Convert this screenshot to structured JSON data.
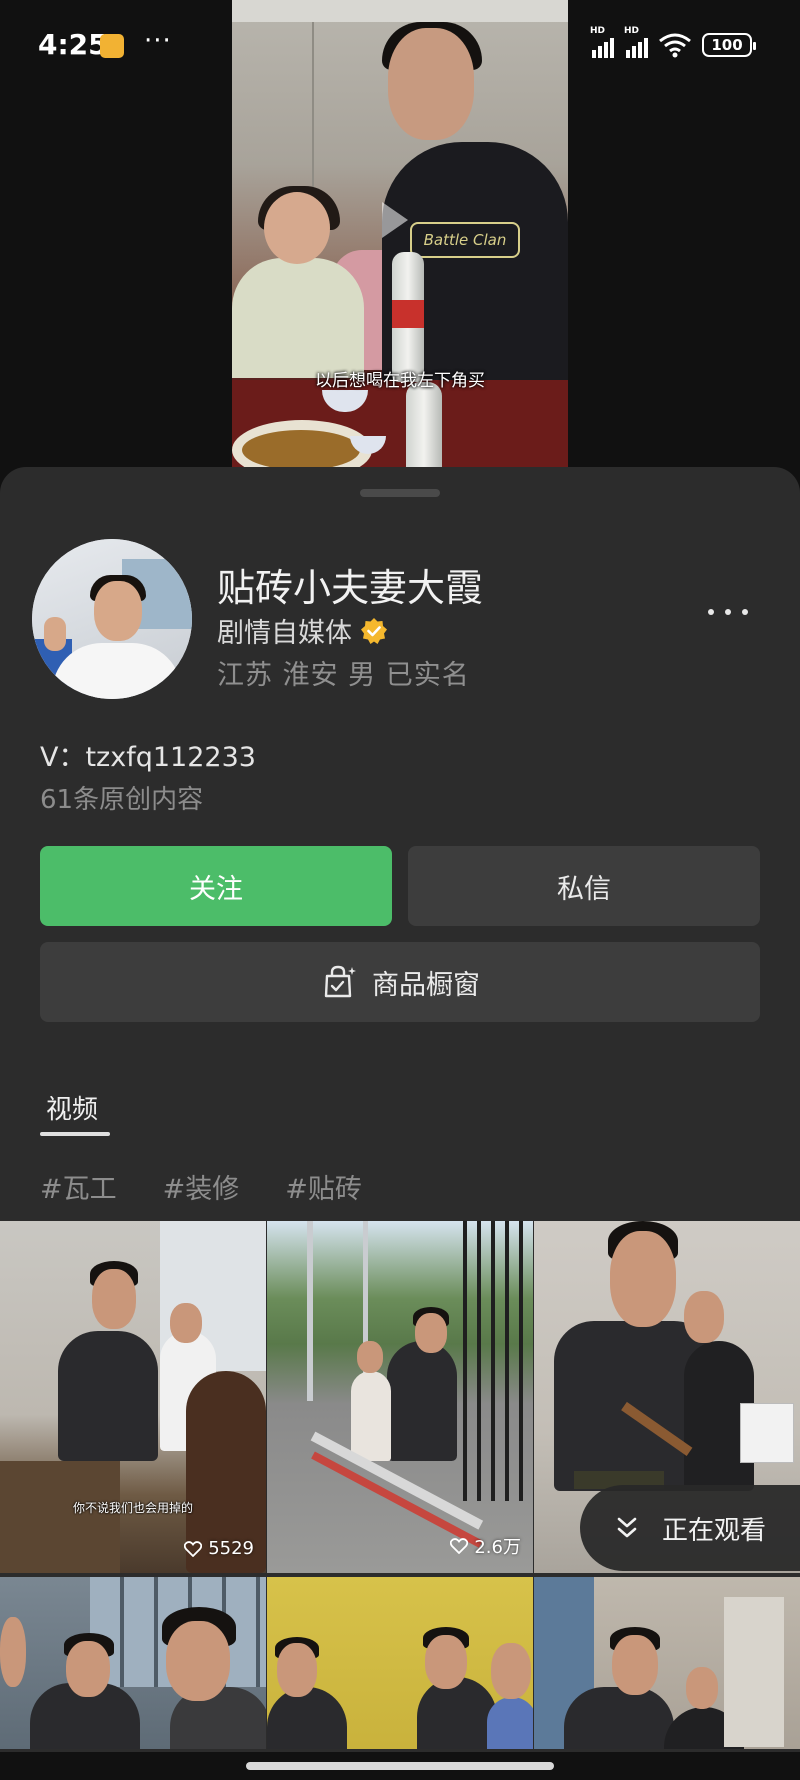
{
  "status_bar": {
    "time": "4:25",
    "app_badge_icon": "notes-app-icon",
    "signal_label_1": "HD",
    "signal_label_2": "HD",
    "battery": "100"
  },
  "video": {
    "subtitle": "以后想喝在我左下角买",
    "shirt_text": "Battle Clan"
  },
  "profile": {
    "name": "贴砖小夫妻大霞",
    "type": "剧情自媒体",
    "location": "江苏 淮安 男 已实名",
    "contact": "V：tzxfq112233",
    "content_count": "61条原创内容",
    "verified_color": "#f5b82e"
  },
  "actions": {
    "follow_label": "关注",
    "message_label": "私信",
    "store_label": "商品橱窗",
    "follow_color": "#4cbd69"
  },
  "tabs": {
    "videos_label": "视频"
  },
  "tags": [
    "#瓦工",
    "#装修",
    "#贴砖"
  ],
  "grid": {
    "items": [
      {
        "caption": "你不说我们也会用掉的",
        "likes": "5529"
      },
      {
        "caption": "",
        "likes": "2.6万"
      },
      {
        "caption": "",
        "likes": ""
      },
      {
        "caption": "",
        "likes": ""
      },
      {
        "caption": "",
        "likes": ""
      },
      {
        "caption": "",
        "likes": ""
      }
    ]
  },
  "watching": {
    "label": "正在观看"
  }
}
